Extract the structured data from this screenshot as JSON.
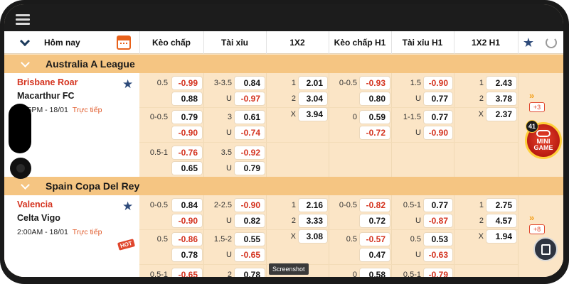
{
  "header": {
    "today": "Hôm nay",
    "columns": [
      "Kèo chấp",
      "Tài xỉu",
      "1X2",
      "Kèo chấp H1",
      "Tài xỉu H1",
      "1X2 H1"
    ]
  },
  "leagues": [
    {
      "name": "Australia A League",
      "match": {
        "home": "Brisbane Roar",
        "away": "Macarthur FC",
        "time": "3:45PM - 18/01",
        "status": "Trực tiếp",
        "more": "+3",
        "rows": [
          {
            "hcap_line": "0.5",
            "hcap": [
              "-0.99",
              "0.88"
            ],
            "ou_line": "3-3.5",
            "ou": [
              "0.84",
              "-0.97"
            ],
            "x12": [
              [
                "1",
                "2.01"
              ],
              [
                "2",
                "3.04"
              ],
              [
                "X",
                "3.94"
              ]
            ],
            "h1_hcap_line": "0-0.5",
            "h1_hcap": [
              "-0.93",
              "0.80"
            ],
            "h1_ou_line": "1.5",
            "h1_ou": [
              "-0.90",
              "0.77"
            ],
            "h1_x12": [
              [
                "1",
                "2.43"
              ],
              [
                "2",
                "3.78"
              ],
              [
                "X",
                "2.37"
              ]
            ]
          },
          {
            "hcap_line": "0-0.5",
            "hcap": [
              "0.79",
              "-0.90"
            ],
            "ou_line": "3",
            "ou": [
              "0.61",
              "-0.74"
            ],
            "h1_hcap_line": "0",
            "h1_hcap": [
              "0.59",
              "-0.72"
            ],
            "h1_ou_line": "1-1.5",
            "h1_ou": [
              "0.77",
              "-0.90"
            ]
          },
          {
            "hcap_line": "0.5-1",
            "hcap": [
              "-0.76",
              "0.65"
            ],
            "ou_line": "3.5",
            "ou": [
              "-0.92",
              "0.79"
            ]
          }
        ]
      }
    },
    {
      "name": "Spain Copa Del Rey",
      "match": {
        "home": "Valencia",
        "away": "Celta Vigo",
        "time": "2:00AM - 18/01",
        "status": "Trực tiếp",
        "hot": "HOT",
        "more": "+8",
        "rows": [
          {
            "hcap_line": "0-0.5",
            "hcap": [
              "0.84",
              "-0.90"
            ],
            "ou_line": "2-2.5",
            "ou": [
              "-0.90",
              "0.82"
            ],
            "x12": [
              [
                "1",
                "2.16"
              ],
              [
                "2",
                "3.33"
              ],
              [
                "X",
                "3.08"
              ]
            ],
            "h1_hcap_line": "0-0.5",
            "h1_hcap": [
              "-0.82",
              "0.72"
            ],
            "h1_ou_line": "0.5-1",
            "h1_ou": [
              "0.77",
              "-0.87"
            ],
            "h1_x12": [
              [
                "1",
                "2.75"
              ],
              [
                "2",
                "4.57"
              ],
              [
                "X",
                "1.94"
              ]
            ]
          },
          {
            "hcap_line": "0.5",
            "hcap": [
              "-0.86",
              "0.78"
            ],
            "ou_line": "1.5-2",
            "ou": [
              "0.55",
              "-0.65"
            ],
            "h1_hcap_line": "0.5",
            "h1_hcap": [
              "-0.57",
              "0.47"
            ],
            "h1_ou_line": "0.5",
            "h1_ou": [
              "0.53",
              "-0.63"
            ]
          },
          {
            "hcap_line": "0.5-1",
            "hcap": [
              "-0.65"
            ],
            "ou_line": "2",
            "ou": [
              "0.78"
            ],
            "h1_hcap_line": "0",
            "h1_hcap": [
              "0.58"
            ],
            "h1_ou_line": "0.5-1",
            "h1_ou": [
              "-0.79"
            ]
          }
        ]
      }
    }
  ],
  "under_label": "U",
  "minigame": {
    "count": "41",
    "line1": "MINI",
    "line2": "GAME"
  },
  "tooltip": "Screenshot",
  "colors": {
    "accent": "#f5c582",
    "negative": "#d4321e",
    "background": "#fbe5c6"
  }
}
